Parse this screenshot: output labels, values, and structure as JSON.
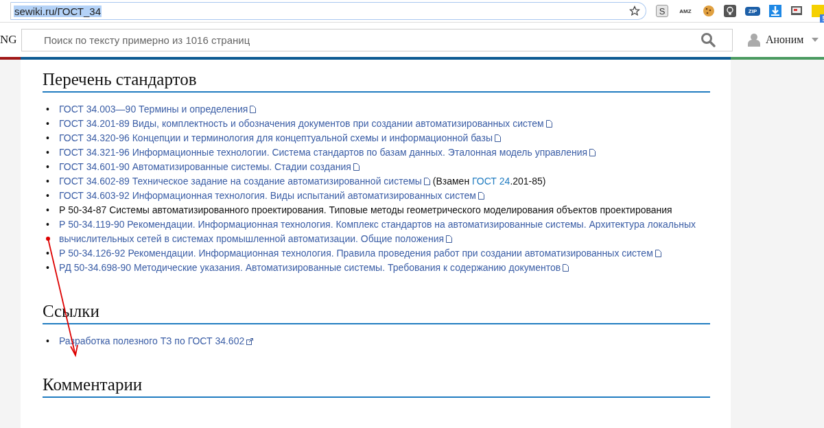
{
  "browser": {
    "url": "sewiki.ru/ГОСТ_34",
    "extensions": [
      {
        "kind": "s",
        "label": "S"
      },
      {
        "kind": "amz",
        "label": "AMZ"
      },
      {
        "kind": "cookie"
      },
      {
        "kind": "bulb"
      },
      {
        "kind": "zip",
        "label": "ZIP"
      },
      {
        "kind": "download"
      },
      {
        "kind": "tv"
      },
      {
        "kind": "note",
        "badge": "!"
      }
    ]
  },
  "header": {
    "logo_fragment": "NG",
    "search": {
      "placeholder": "Поиск по тексту примерно из 1016 страниц"
    },
    "user": {
      "name": "Аноним"
    }
  },
  "sections": [
    {
      "title": "Перечень стандартов",
      "items": [
        {
          "marker": "•",
          "parts": [
            {
              "kind": "doc_link",
              "text": "ГОСТ 34.003—90 Термины и определения"
            }
          ]
        },
        {
          "marker": "•",
          "parts": [
            {
              "kind": "doc_link",
              "text": "ГОСТ 34.201-89 Виды, комплектность и обозначения документов при создании автоматизированных систем"
            }
          ]
        },
        {
          "marker": "•",
          "parts": [
            {
              "kind": "doc_link",
              "text": "ГОСТ 34.320-96 Концепции и терминология для концептуальной схемы и информационной базы"
            }
          ]
        },
        {
          "marker": "•",
          "parts": [
            {
              "kind": "doc_link",
              "text": "ГОСТ 34.321-96 Информационные технологии. Система стандартов по базам данных. Эталонная модель управления"
            }
          ]
        },
        {
          "marker": "•",
          "parts": [
            {
              "kind": "doc_link",
              "text": "ГОСТ 34.601-90 Автоматизированные системы. Стадии создания"
            }
          ]
        },
        {
          "marker": "•",
          "parts": [
            {
              "kind": "doc_link",
              "text": "ГОСТ 34.602-89 Техническое задание на создание автоматизированной системы"
            },
            {
              "kind": "text",
              "text": "(Взамен"
            },
            {
              "kind": "plain_link",
              "text": "ГОСТ 24"
            },
            {
              "kind": "text",
              "text": ".201-85)"
            }
          ]
        },
        {
          "marker": "•",
          "parts": [
            {
              "kind": "doc_link",
              "text": "ГОСТ 34.603-92 Информационная технология. Виды испытаний автоматизированных систем"
            }
          ]
        },
        {
          "marker": "•",
          "parts": [
            {
              "kind": "text",
              "text": "Р 50-34-87 Системы автоматизированного проектирования. Типовые методы геометрического моделирования объектов проектирования"
            }
          ]
        },
        {
          "marker": "•",
          "parts": [
            {
              "kind": "doc_link",
              "text": "Р 50-34.119-90 Рекомендации. Информационная технология. Комплекс стандартов на автоматизированные системы. Архитектура локальных вычислительных сетей в системах промышленной автоматизации. Общие положения"
            }
          ]
        },
        {
          "marker": "•",
          "parts": [
            {
              "kind": "doc_link",
              "text": "Р 50-34.126-92 Рекомендации. Информационная технология. Правила проведения работ при создании автоматизированных систем"
            }
          ]
        },
        {
          "marker": "•",
          "parts": [
            {
              "kind": "doc_link",
              "text": "РД 50-34.698-90 Методические указания. Автоматизированные системы. Требования к содержанию документов"
            }
          ]
        }
      ]
    },
    {
      "title": "Ссылки",
      "items": [
        {
          "marker": "•",
          "parts": [
            {
              "kind": "external_link",
              "text": "Разработка полезного ТЗ по ГОСТ 34.602"
            }
          ]
        }
      ]
    },
    {
      "title": "Комментарии"
    }
  ]
}
